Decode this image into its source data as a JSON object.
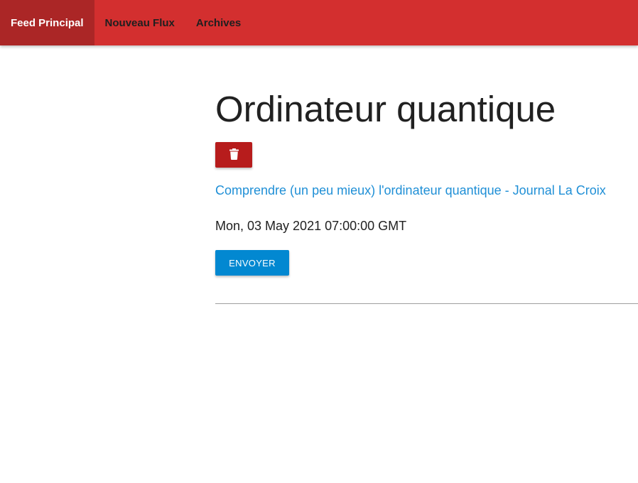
{
  "nav": {
    "items": [
      {
        "label": "Feed Principal",
        "active": true
      },
      {
        "label": "Nouveau Flux",
        "active": false
      },
      {
        "label": "Archives",
        "active": false
      }
    ]
  },
  "article": {
    "title": "Ordinateur quantique",
    "delete_icon": "trash-icon",
    "link_text": "Comprendre (un peu mieux) l'ordinateur quantique - Journal La Croix",
    "date": "Mon, 03 May 2021 07:00:00 GMT",
    "send_label": "ENVOYER"
  },
  "colors": {
    "navbar": "#d32f2f",
    "nav_active": "#ab2626",
    "delete_button": "#b71c1c",
    "send_button": "#0288d1",
    "link": "#1f8fd6"
  }
}
